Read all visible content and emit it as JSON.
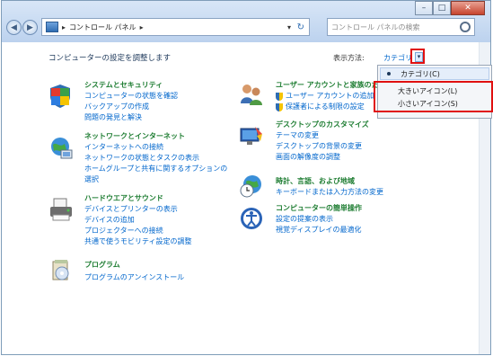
{
  "window": {
    "caption_buttons": [
      "–",
      "□",
      "✕"
    ],
    "nav_back": "◀",
    "nav_forward": "▶"
  },
  "address_bar": {
    "path_item": "コントロール パネル",
    "separator": "▸",
    "dropdown": "▾",
    "refresh": "↻"
  },
  "search": {
    "placeholder": "コントロール パネルの検索",
    "icon": "search-icon"
  },
  "header": {
    "title": "コンピューターの設定を調整します",
    "view_by_label": "表示方法:",
    "view_by_value": "カテゴリ"
  },
  "categories": [
    {
      "title": "システムとセキュリティ",
      "links": [
        "コンピューターの状態を確認",
        "バックアップの作成",
        "問題の発見と解決"
      ]
    },
    {
      "title": "ネットワークとインターネット",
      "links": [
        "インターネットへの接続",
        "ネットワークの状態とタスクの表示",
        "ホームグループと共有に関するオプションの",
        "選択"
      ]
    },
    {
      "title": "ハードウエアとサウンド",
      "links": [
        "デバイスとプリンターの表示",
        "デバイスの追加",
        "プロジェクターへの接続",
        "共通で使うモビリティ設定の調整"
      ]
    },
    {
      "title": "プログラム",
      "links": [
        "プログラムのアンインストール"
      ]
    },
    {
      "title": "ユーザー アカウントと家族のた",
      "links": [
        "ユーザー アカウントの追加",
        "保護者による制限の設定"
      ]
    },
    {
      "title": "デスクトップのカスタマイズ",
      "links": [
        "テーマの変更",
        "デスクトップの背景の変更",
        "画面の解像度の調整"
      ]
    },
    {
      "title": "時計、言語、および地域",
      "links": [
        "キーボードまたは入力方法の変更"
      ]
    },
    {
      "title": "コンピューターの簡単操作",
      "links": [
        "設定の提案の表示",
        "視覚ディスプレイの最適化"
      ]
    }
  ],
  "view_menu": {
    "items": [
      "カテゴリ(C)",
      "大きいアイコン(L)",
      "小さいアイコン(S)"
    ],
    "selected": "カテゴリ(C)"
  },
  "colors": {
    "link": "#0066cc",
    "category_title": "#1e7d32",
    "highlight": "#e01010"
  }
}
